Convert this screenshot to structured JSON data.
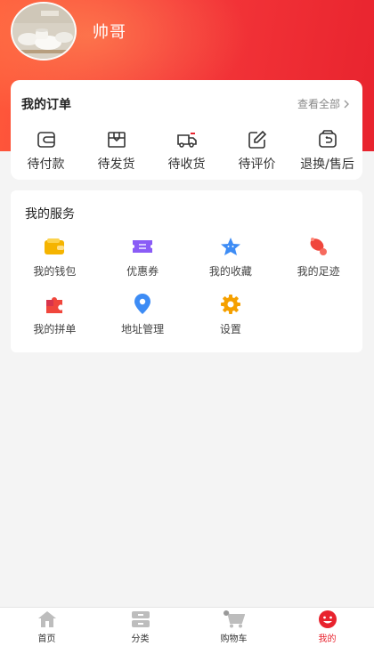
{
  "profile": {
    "username": "帅哥",
    "avatar_icon": "avatar-tableware-photo"
  },
  "orders": {
    "title": "我的订单",
    "view_all": "查看全部",
    "items": [
      {
        "label": "待付款",
        "icon": "wallet-icon"
      },
      {
        "label": "待发货",
        "icon": "box-icon"
      },
      {
        "label": "待收货",
        "icon": "truck-icon"
      },
      {
        "label": "待评价",
        "icon": "edit-icon"
      },
      {
        "label": "退换/售后",
        "icon": "return-icon"
      }
    ]
  },
  "services": {
    "title": "我的服务",
    "items": [
      {
        "label": "我的钱包",
        "icon": "wallet-icon",
        "color": "#f5b400"
      },
      {
        "label": "优惠券",
        "icon": "coupon-icon",
        "color": "#8a5cf6"
      },
      {
        "label": "我的收藏",
        "icon": "star-icon",
        "color": "#3d8cf5"
      },
      {
        "label": "我的足迹",
        "icon": "footprint-icon",
        "color": "#f0463c"
      },
      {
        "label": "我的拼单",
        "icon": "puzzle-icon",
        "color": "#f0463c"
      },
      {
        "label": "地址管理",
        "icon": "location-icon",
        "color": "#3d8cf5"
      },
      {
        "label": "设置",
        "icon": "gear-icon",
        "color": "#f5a000"
      }
    ]
  },
  "tabbar": {
    "tabs": [
      {
        "label": "首页",
        "icon": "home-icon"
      },
      {
        "label": "分类",
        "icon": "category-icon"
      },
      {
        "label": "购物车",
        "icon": "cart-icon"
      },
      {
        "label": "我的",
        "icon": "smile-icon",
        "active": true
      }
    ]
  },
  "colors": {
    "accent": "#e8232e",
    "header_start": "#ff5a3a",
    "background": "#f4f4f4"
  }
}
